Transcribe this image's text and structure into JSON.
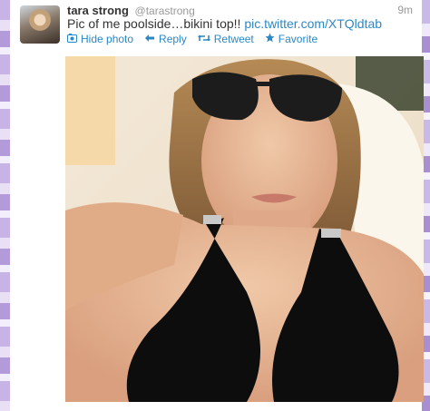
{
  "tweet": {
    "name": "tara strong",
    "handle": "@tarastrong",
    "time": "9m",
    "text": "Pic of me poolside…bikini top!! ",
    "link": "pic.twitter.com/XTQldtab",
    "actions": {
      "hide_photo": "Hide photo",
      "reply": "Reply",
      "retweet": "Retweet",
      "favorite": "Favorite"
    }
  },
  "icons": {
    "hide_photo": "photo-icon",
    "reply": "reply-arrow-icon",
    "retweet": "retweet-icon",
    "favorite": "star-icon"
  },
  "colors": {
    "link": "#2a88c6",
    "text": "#333333",
    "muted": "#999999"
  }
}
